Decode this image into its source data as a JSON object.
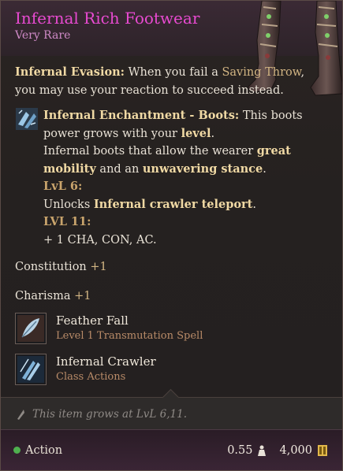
{
  "item": {
    "name": "Infernal Rich Footwear",
    "rarity": "Very Rare"
  },
  "passive": {
    "name": "Infernal Evasion:",
    "text_a": " When you fail a ",
    "link": "Saving Throw",
    "text_b": ", you may use your reaction to succeed instead."
  },
  "enchant": {
    "name": "Infernal Enchantment - Boots:",
    "text_a": " This boots power grows with your ",
    "level_word": "level",
    "text_b": ".",
    "desc_a": "Infernal boots that allow the wearer ",
    "desc_kw1": "great mobility",
    "desc_b": " and an ",
    "desc_kw2": "unwavering stance",
    "desc_c": ".",
    "lvl6_label": "LvL 6:",
    "lvl6_a": "Unlocks ",
    "lvl6_kw": "Infernal crawler teleport",
    "lvl6_b": ".",
    "lvl11_label": "LVL 11:",
    "lvl11_text": "+ 1 CHA, CON, AC."
  },
  "stats": [
    {
      "label": "Constitution",
      "bonus": "+1"
    },
    {
      "label": "Charisma",
      "bonus": "+1"
    }
  ],
  "spells": [
    {
      "name": "Feather Fall",
      "sub": "Level 1 Transmutation Spell",
      "icon": "feather-icon"
    },
    {
      "name": "Infernal Crawler",
      "sub": "Class Actions",
      "icon": "claw-icon"
    }
  ],
  "growth_note": "This item grows at LvL 6,11.",
  "footer": {
    "action_label": "Action",
    "weight": "0.55",
    "price": "4,000"
  },
  "colors": {
    "title": "#e84ad1",
    "rarity": "#cf8ac6",
    "keyword": "#f0d9a4",
    "level_label": "#c9a46c",
    "action_dot": "#4fb04f"
  }
}
